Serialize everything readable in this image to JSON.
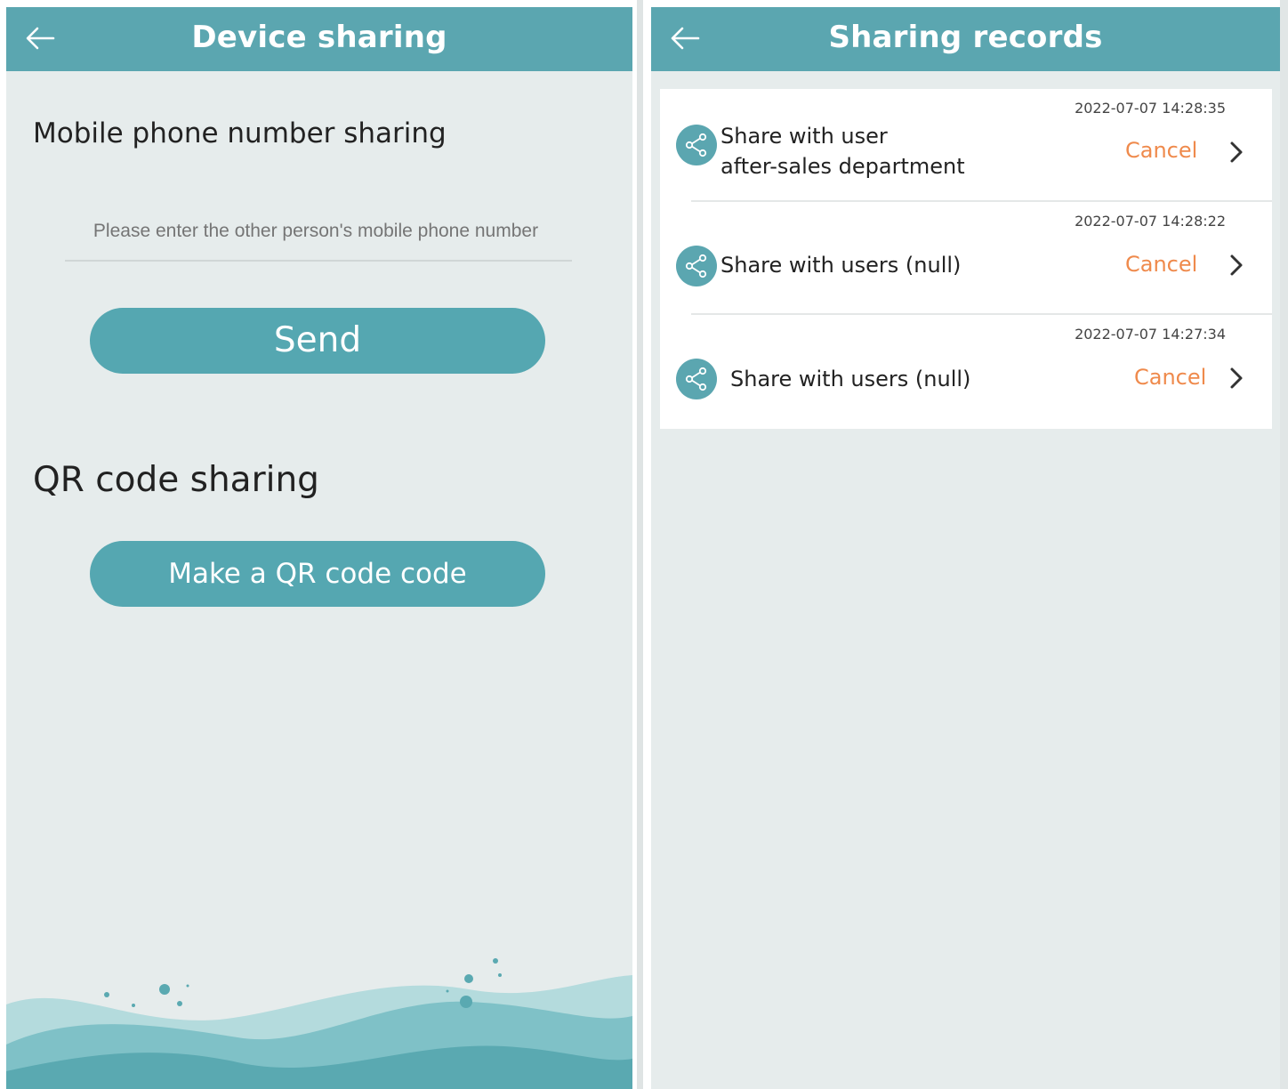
{
  "colors": {
    "accent": "#5ba6b0",
    "button": "#55a7b1",
    "cancel": "#ef8a4c",
    "background": "#e6ecec"
  },
  "device_sharing": {
    "title": "Device sharing",
    "back_icon": "arrow-left-icon",
    "mobile_heading": "Mobile phone number sharing",
    "phone_placeholder": "Please enter the other person's mobile phone number",
    "send_label": "Send",
    "qr_heading": "QR code  sharing",
    "qr_button_label": "Make a QR code  code"
  },
  "sharing_records": {
    "title": "Sharing records",
    "back_icon": "arrow-left-icon",
    "records": [
      {
        "timestamp": "2022-07-07 14:28:35",
        "line1": "Share with user",
        "line2": "after-sales department",
        "cancel": "Cancel",
        "icon": "share-icon"
      },
      {
        "timestamp": "2022-07-07 14:28:22",
        "line1": "Share with users (null)",
        "line2": "",
        "cancel": "Cancel",
        "icon": "share-icon"
      },
      {
        "timestamp": "2022-07-07 14:27:34",
        "line1": "Share with users (null)",
        "line2": "",
        "cancel": "Cancel",
        "icon": "share-icon"
      }
    ]
  }
}
